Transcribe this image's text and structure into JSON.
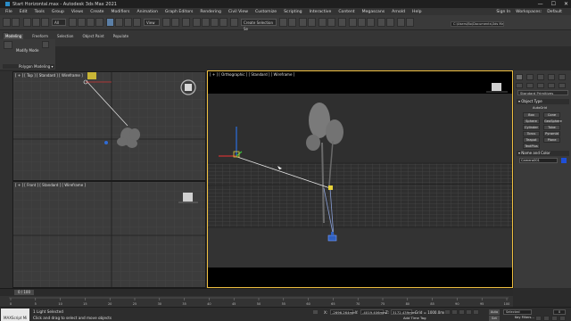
{
  "window": {
    "title": "Start Horizontal.max - Autodesk 3ds Max 2021",
    "controls": [
      "—",
      "☐",
      "✕"
    ]
  },
  "menubar": {
    "items": [
      "File",
      "Edit",
      "Tools",
      "Group",
      "Views",
      "Create",
      "Modifiers",
      "Animation",
      "Graph Editors",
      "Rendering",
      "Civil View",
      "Customize",
      "Scripting",
      "Interactive",
      "Content",
      "Megascans",
      "Arnold",
      "Help"
    ],
    "sign_in": "Sign In",
    "workspaces_label": "Workspaces:",
    "workspaces_value": "Default"
  },
  "toolbar": {
    "selection_filter": "All",
    "view_dropdown": "View",
    "create_selection_set": "Create Selection Se",
    "project_path": "C:\\Users\\Bo\\Documents\\3ds Max 2021 ▾"
  },
  "ribbon": {
    "tabs": [
      "Modeling",
      "Freeform",
      "Selection",
      "Object Paint",
      "Populate"
    ],
    "active_tab": "Modeling",
    "modify_mode": "Modify Mode",
    "polygon_modeling": "Polygon Modeling ▾"
  },
  "viewports": {
    "top": {
      "label": "[ + ] [ Top ] [ Standard ] [ Wireframe ]"
    },
    "front": {
      "label": "[ + ] [ Front ] [ Standard ] [ Wireframe ]"
    },
    "ortho": {
      "label": "[ + ] [ Orthographic ] [ Standard ] [ Wireframe ]"
    }
  },
  "command_panel": {
    "dropdown": "Standard Primitives",
    "object_type_title": "▾ Object Type",
    "autogrid": "AutoGrid",
    "buttons": [
      "Box",
      "Cone",
      "Sphere",
      "GeoSphere",
      "Cylinder",
      "Tube",
      "Torus",
      "Pyramid",
      "Teapot",
      "Plane",
      "TextPlus"
    ],
    "name_color_title": "▾ Name and Color",
    "object_name": "Camera001",
    "object_color": "#1f4fd8"
  },
  "timeline": {
    "frame_counter": "0 / 100",
    "ticks": [
      "0",
      "5",
      "10",
      "15",
      "20",
      "25",
      "30",
      "35",
      "40",
      "45",
      "50",
      "55",
      "60",
      "65",
      "70",
      "75",
      "80",
      "85",
      "90",
      "95",
      "100"
    ]
  },
  "statusbar": {
    "maxscript": "MAXScript Mi",
    "status_line_1": "1 Light Selected",
    "status_line_2": "Click and drag to select and move objects",
    "x_label": "X:",
    "x_value": "-2696.264mm",
    "y_label": "Y:",
    "y_value": "-4019.406mm",
    "z_label": "Z:",
    "z_value": "3172.439mm",
    "grid": "Grid = 1000.0mm",
    "add_time_tag": "Add Time Tag",
    "auto_key": "Auto Key",
    "set_key": "Set Key",
    "selected": "Selected",
    "key_filters": "Key Filters...",
    "frame_field": "0"
  }
}
